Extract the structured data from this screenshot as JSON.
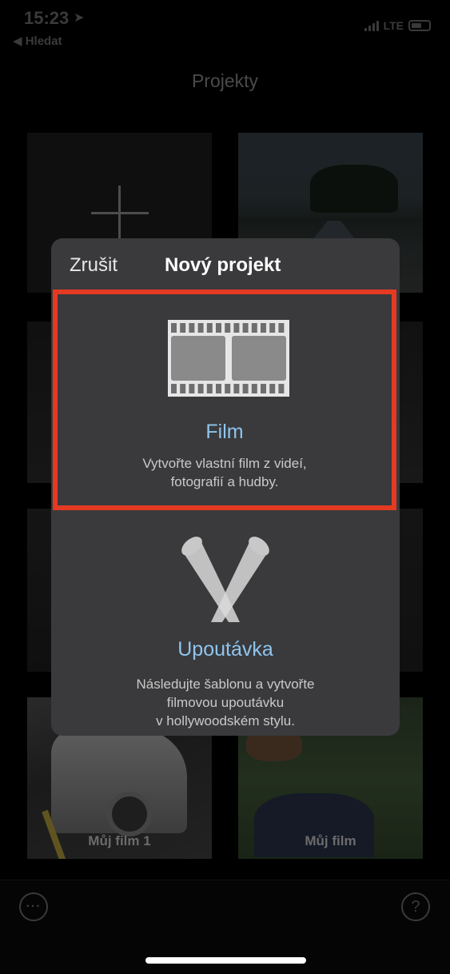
{
  "status": {
    "time": "15:23",
    "back_label": "◀ Hledat",
    "network": "LTE"
  },
  "nav": {
    "title": "Projekty"
  },
  "projects": [
    {
      "label": ""
    },
    {
      "label": ""
    },
    {
      "label": ""
    },
    {
      "label": ""
    },
    {
      "label": ""
    },
    {
      "label": ""
    },
    {
      "label": "Můj film 1"
    },
    {
      "label": "Můj film"
    }
  ],
  "modal": {
    "cancel_label": "Zrušit",
    "title": "Nový projekt",
    "options": [
      {
        "title": "Film",
        "description_lines": [
          "Vytvořte vlastní film z videí,",
          "fotografií a hudby."
        ],
        "icon": "film-strip-icon",
        "highlighted": true,
        "highlight_color": "#e53a22"
      },
      {
        "title": "Upoutávka",
        "description_lines": [
          "Následujte šablonu a vytvořte",
          "filmovou upoutávku",
          "v hollywoodském stylu."
        ],
        "icon": "spotlights-icon",
        "highlighted": false
      }
    ]
  },
  "toolbar": {
    "more_icon": "ellipsis-icon",
    "help_icon": "question-icon",
    "more_glyph": "···",
    "help_glyph": "?"
  },
  "colors": {
    "accent_text": "#8ec5ef",
    "highlight": "#e53a22",
    "modal_bg": "#3a3a3c"
  }
}
